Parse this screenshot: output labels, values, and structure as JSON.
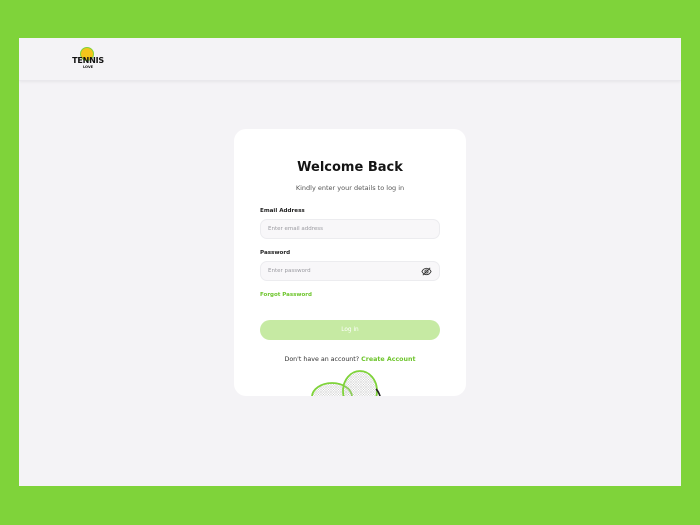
{
  "brand": {
    "logo_text": "TENNIS",
    "logo_subtext": "LOVE",
    "accent_color": "#7fd33a",
    "link_color": "#6cc42a"
  },
  "login": {
    "title": "Welcome Back",
    "subtitle": "Kindly enter your details to log in",
    "email_label": "Email Address",
    "email_placeholder": "Enter email address",
    "email_value": "",
    "password_label": "Password",
    "password_placeholder": "Enter password",
    "password_value": "",
    "password_toggle_icon": "eye-off-icon",
    "forgot_password": "Forgot Password",
    "login_button": "Log in",
    "no_account_text": "Don't have an account?",
    "create_account": "Create Account"
  },
  "illustration": {
    "icon": "tennis-rackets-icon"
  }
}
